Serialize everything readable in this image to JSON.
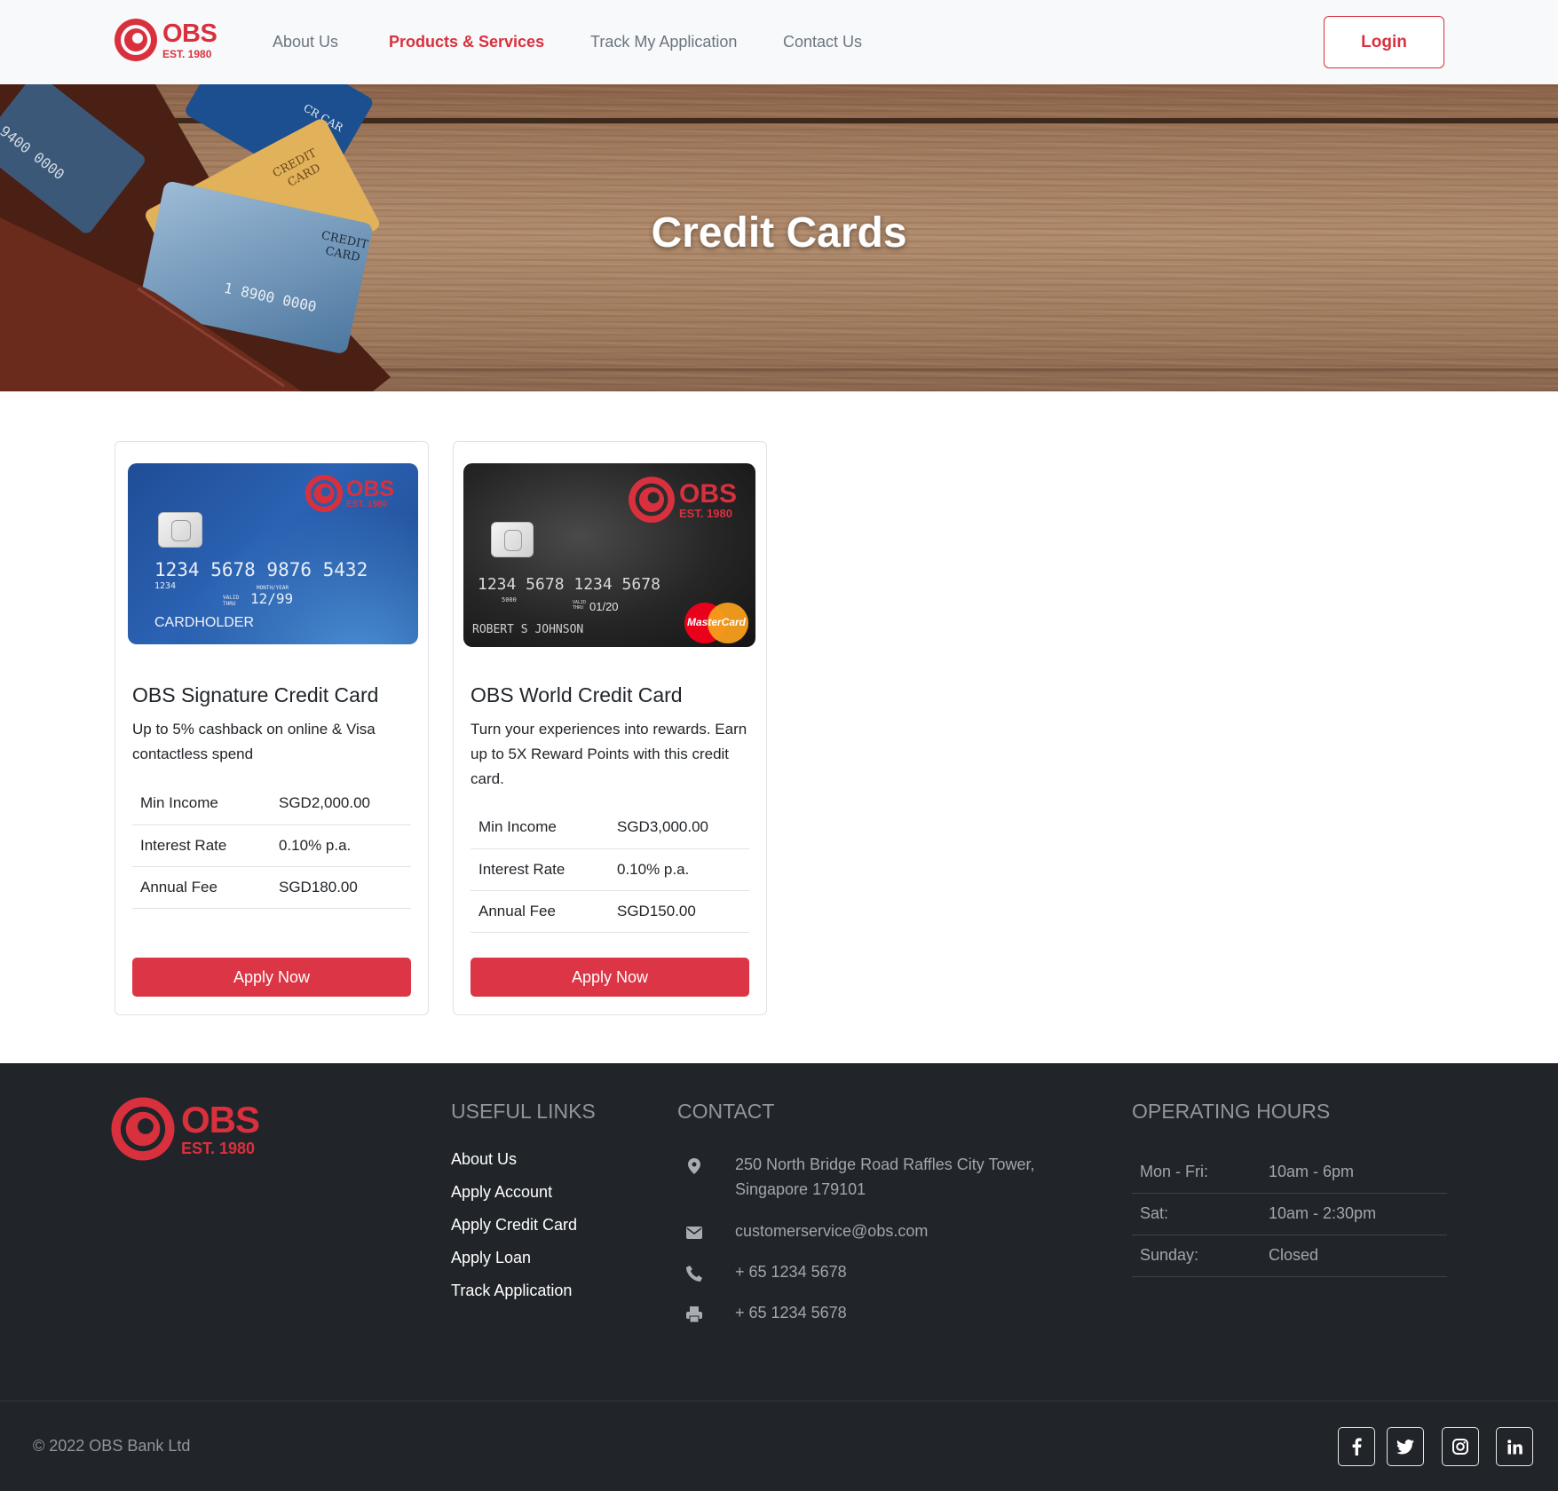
{
  "brand": {
    "name": "OBS",
    "est": "EST. 1980",
    "primary_color": "#dc3545",
    "dark_color": "#212529"
  },
  "nav": {
    "links": [
      {
        "label": "About Us",
        "active": false
      },
      {
        "label": "Products & Services",
        "active": true
      },
      {
        "label": "Track My Application",
        "active": false
      },
      {
        "label": "Contact Us",
        "active": false
      }
    ],
    "login_label": "Login"
  },
  "hero": {
    "title": "Credit Cards",
    "art_text": {
      "card_label_1": "CREDIT",
      "card_label_2": "CARD",
      "card_number_fragment": "1 8900 0000",
      "card_corner_fragment": "9400 0000",
      "top_card_fragment": "CR CAR"
    }
  },
  "products": [
    {
      "title": "OBS Signature Credit Card",
      "description": "Up to 5% cashback on online & Visa contactless spend",
      "card_image": {
        "style": "blue",
        "number": "1234 5678 9876 5432",
        "small_number": "1234",
        "valid_label": "VALID THRU",
        "month_year_label": "MONTH/YEAR",
        "expiry": "12/99",
        "holder": "CARDHOLDER"
      },
      "details": [
        {
          "label": "Min Income",
          "value": "SGD2,000.00"
        },
        {
          "label": "Interest Rate",
          "value": "0.10% p.a."
        },
        {
          "label": "Annual Fee",
          "value": "SGD180.00"
        }
      ],
      "apply_label": "Apply Now"
    },
    {
      "title": "OBS World Credit Card",
      "description": "Turn your experiences into rewards. Earn up to 5X Reward Points with this credit card.",
      "card_image": {
        "style": "black",
        "number": "1234 5678 1234 5678",
        "small_number": "5000",
        "valid_label": "VALID THRU",
        "expiry": "01/20",
        "holder": "ROBERT S JOHNSON",
        "network": "MasterCard"
      },
      "details": [
        {
          "label": "Min Income",
          "value": "SGD3,000.00"
        },
        {
          "label": "Interest Rate",
          "value": "0.10% p.a."
        },
        {
          "label": "Annual Fee",
          "value": "SGD150.00"
        }
      ],
      "apply_label": "Apply Now"
    }
  ],
  "footer": {
    "useful_links_heading": "USEFUL LINKS",
    "useful_links": [
      "About Us",
      "Apply Account",
      "Apply Credit Card",
      "Apply Loan",
      "Track Application"
    ],
    "contact_heading": "CONTACT",
    "contact": [
      {
        "icon": "map-marker-icon",
        "text": "250 North Bridge Road Raffles City Tower, Singapore 179101"
      },
      {
        "icon": "envelope-icon",
        "text": "customerservice@obs.com"
      },
      {
        "icon": "phone-icon",
        "text": "+ 65 1234 5678"
      },
      {
        "icon": "fax-icon",
        "text": "+ 65 1234 5678"
      }
    ],
    "hours_heading": "OPERATING HOURS",
    "hours": [
      {
        "day": "Mon - Fri:",
        "time": "10am - 6pm"
      },
      {
        "day": "Sat:",
        "time": "10am - 2:30pm"
      },
      {
        "day": "Sunday:",
        "time": "Closed"
      }
    ],
    "copyright": "© 2022 OBS Bank Ltd",
    "social": [
      "facebook-icon",
      "twitter-icon",
      "instagram-icon",
      "linkedin-icon"
    ]
  }
}
